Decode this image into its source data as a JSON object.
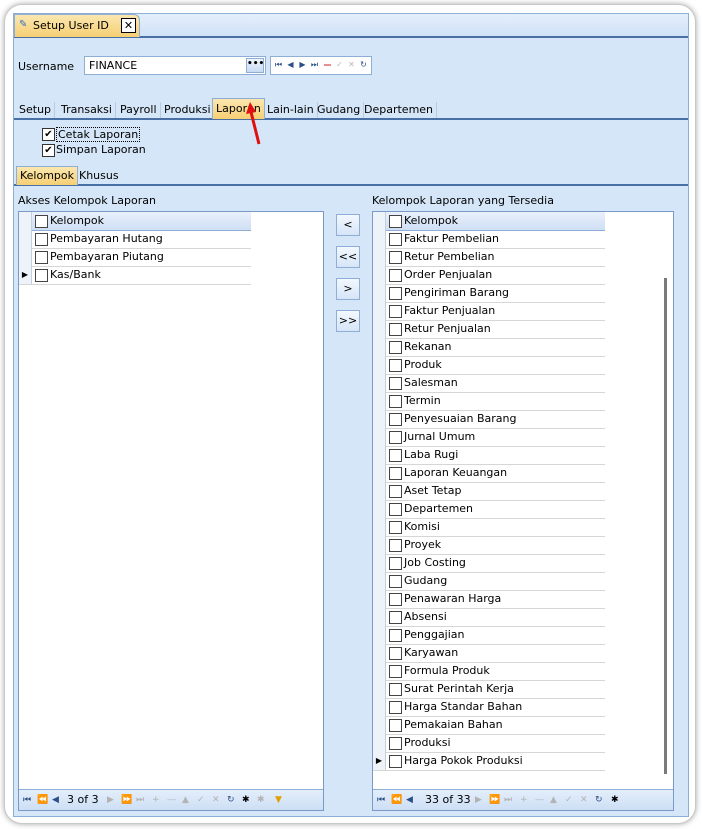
{
  "document_tab": {
    "title": "Setup User ID",
    "close": "✕"
  },
  "username": {
    "label": "Username",
    "value": "FINANCE",
    "lookup": "•••"
  },
  "module_tabs": [
    "Setup",
    "Transaksi",
    "Payroll",
    "Produksi",
    "Laporan",
    "Lain-lain",
    "Gudang",
    "Departemen"
  ],
  "module_tab_active": "Laporan",
  "permissions": [
    {
      "label": "Cetak Laporan",
      "checked": true
    },
    {
      "label": "Simpan Laporan",
      "checked": true
    }
  ],
  "sub_tabs": [
    "Kelompok",
    "Khusus"
  ],
  "left_panel": {
    "title": "Akses Kelompok Laporan",
    "column": "Kelompok",
    "rows": [
      "Pembayaran Hutang",
      "Pembayaran Piutang",
      "Kas/Bank"
    ],
    "record_text": "3 of 3"
  },
  "right_panel": {
    "title": "Kelompok Laporan yang Tersedia",
    "column": "Kelompok",
    "rows": [
      "Faktur Pembelian",
      "Retur Pembelian",
      "Order Penjualan",
      "Pengiriman Barang",
      "Faktur Penjualan",
      "Retur Penjualan",
      "Rekanan",
      "Produk",
      "Salesman",
      "Termin",
      "Penyesuaian Barang",
      "Jurnal Umum",
      "Laba Rugi",
      "Laporan Keuangan",
      "Aset Tetap",
      "Departemen",
      "Komisi",
      "Proyek",
      "Job Costing",
      "Gudang",
      "Penawaran Harga",
      "Absensi",
      "Penggajian",
      "Karyawan",
      "Formula Produk",
      "Surat Perintah Kerja",
      "Harga Standar Bahan",
      "Pemakaian Bahan",
      "Produksi",
      "Harga Pokok Produksi"
    ],
    "record_text": "33 of 33"
  },
  "move_buttons": [
    "<",
    "<<",
    ">",
    ">>"
  ],
  "colors": {
    "accent": "#f6cf73",
    "panel": "#d5e6f8",
    "border": "#8eaed6",
    "arrow": "#e01010"
  }
}
